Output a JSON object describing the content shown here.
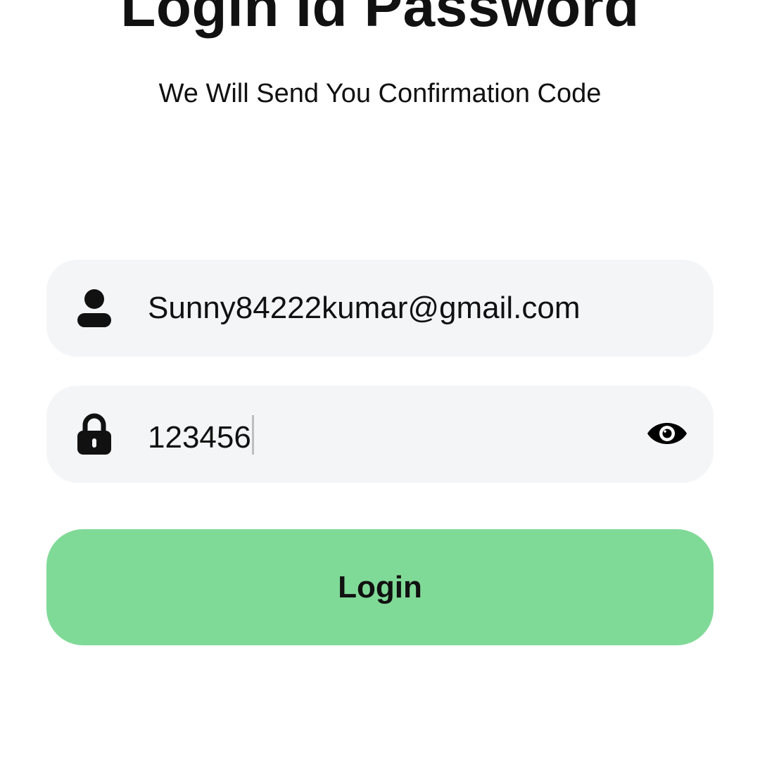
{
  "header": {
    "title": "Login Id Password",
    "subtitle": "We Will Send You Confirmation Code"
  },
  "form": {
    "email": {
      "value": "Sunny84222kumar@gmail.com",
      "icon": "user-icon"
    },
    "password": {
      "value": "123456",
      "icon": "lock-icon",
      "toggle_icon": "eye-icon"
    },
    "submit_label": "Login"
  },
  "colors": {
    "background": "#ffffff",
    "field_background": "#f4f5f7",
    "button_background": "#80da97",
    "text": "#111111"
  }
}
